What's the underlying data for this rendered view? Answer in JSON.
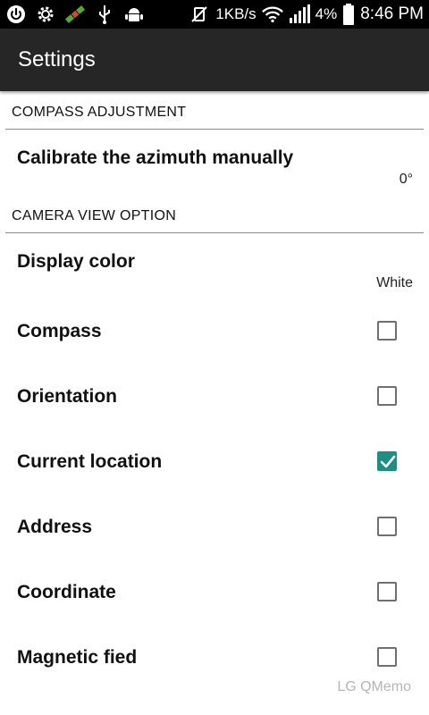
{
  "status_bar": {
    "speed": "1KB/s",
    "battery": "4%",
    "time": "8:46 PM",
    "icons": [
      "power-icon",
      "gear-icon",
      "satellite-icon",
      "usb-icon",
      "android-icon",
      "vibrate-off-icon",
      "wifi-icon",
      "signal-icon",
      "battery-icon"
    ]
  },
  "action_bar": {
    "title": "Settings"
  },
  "sections": {
    "compass": {
      "header": "COMPASS ADJUSTMENT",
      "calibrate_title": "Calibrate the azimuth manually",
      "calibrate_value": "0°"
    },
    "camera": {
      "header": "CAMERA VIEW OPTION",
      "display_color_title": "Display color",
      "display_color_value": "White",
      "options": [
        {
          "label": "Compass",
          "checked": false
        },
        {
          "label": "Orientation",
          "checked": false
        },
        {
          "label": "Current location",
          "checked": true
        },
        {
          "label": "Address",
          "checked": false
        },
        {
          "label": "Coordinate",
          "checked": false
        },
        {
          "label": "Magnetic fied",
          "checked": false
        }
      ]
    }
  },
  "watermark": "LG QMemo",
  "colors": {
    "accent": "#1a8f82",
    "action_bar": "#262626",
    "status_bar": "#000000"
  }
}
